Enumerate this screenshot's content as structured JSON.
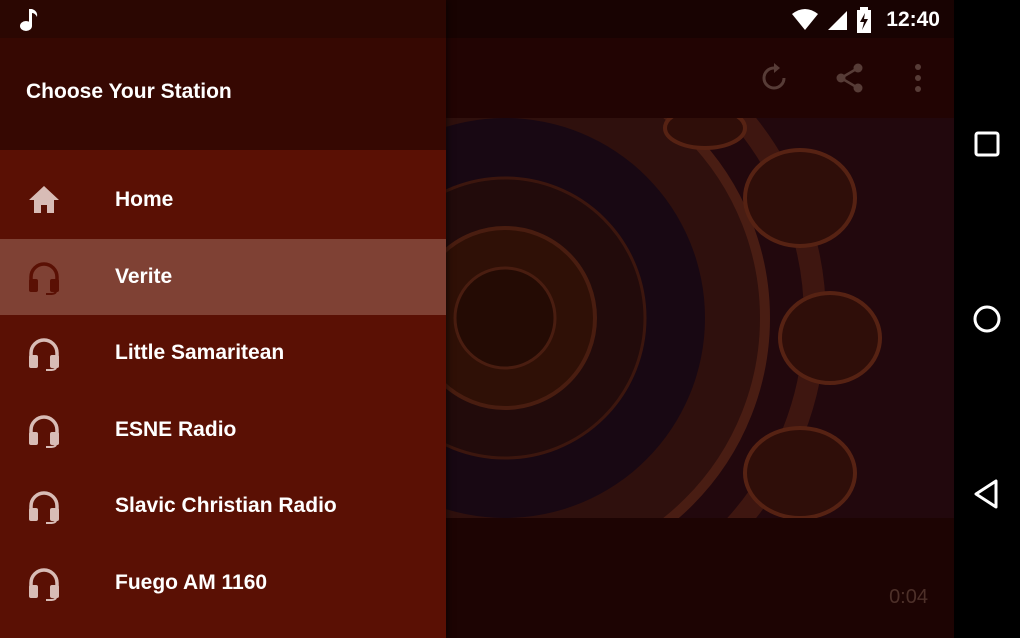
{
  "status_bar": {
    "time": "12:40"
  },
  "drawer": {
    "title": "Choose Your Station",
    "items": [
      {
        "label": "Home",
        "icon": "home-icon",
        "selected": false
      },
      {
        "label": "Verite",
        "icon": "headphones-icon",
        "selected": true
      },
      {
        "label": "Little Samaritean",
        "icon": "headphones-icon",
        "selected": false
      },
      {
        "label": "ESNE Radio",
        "icon": "headphones-icon",
        "selected": false
      },
      {
        "label": "Slavic Christian Radio",
        "icon": "headphones-icon",
        "selected": false
      },
      {
        "label": "Fuego AM 1160",
        "icon": "headphones-icon",
        "selected": false
      }
    ]
  },
  "player": {
    "elapsed": "0:04"
  },
  "colors": {
    "drawer_bg": "#5a1004",
    "drawer_header": "#360802",
    "selected_item": "#7f4134",
    "play_accent": "#8a7a14"
  }
}
